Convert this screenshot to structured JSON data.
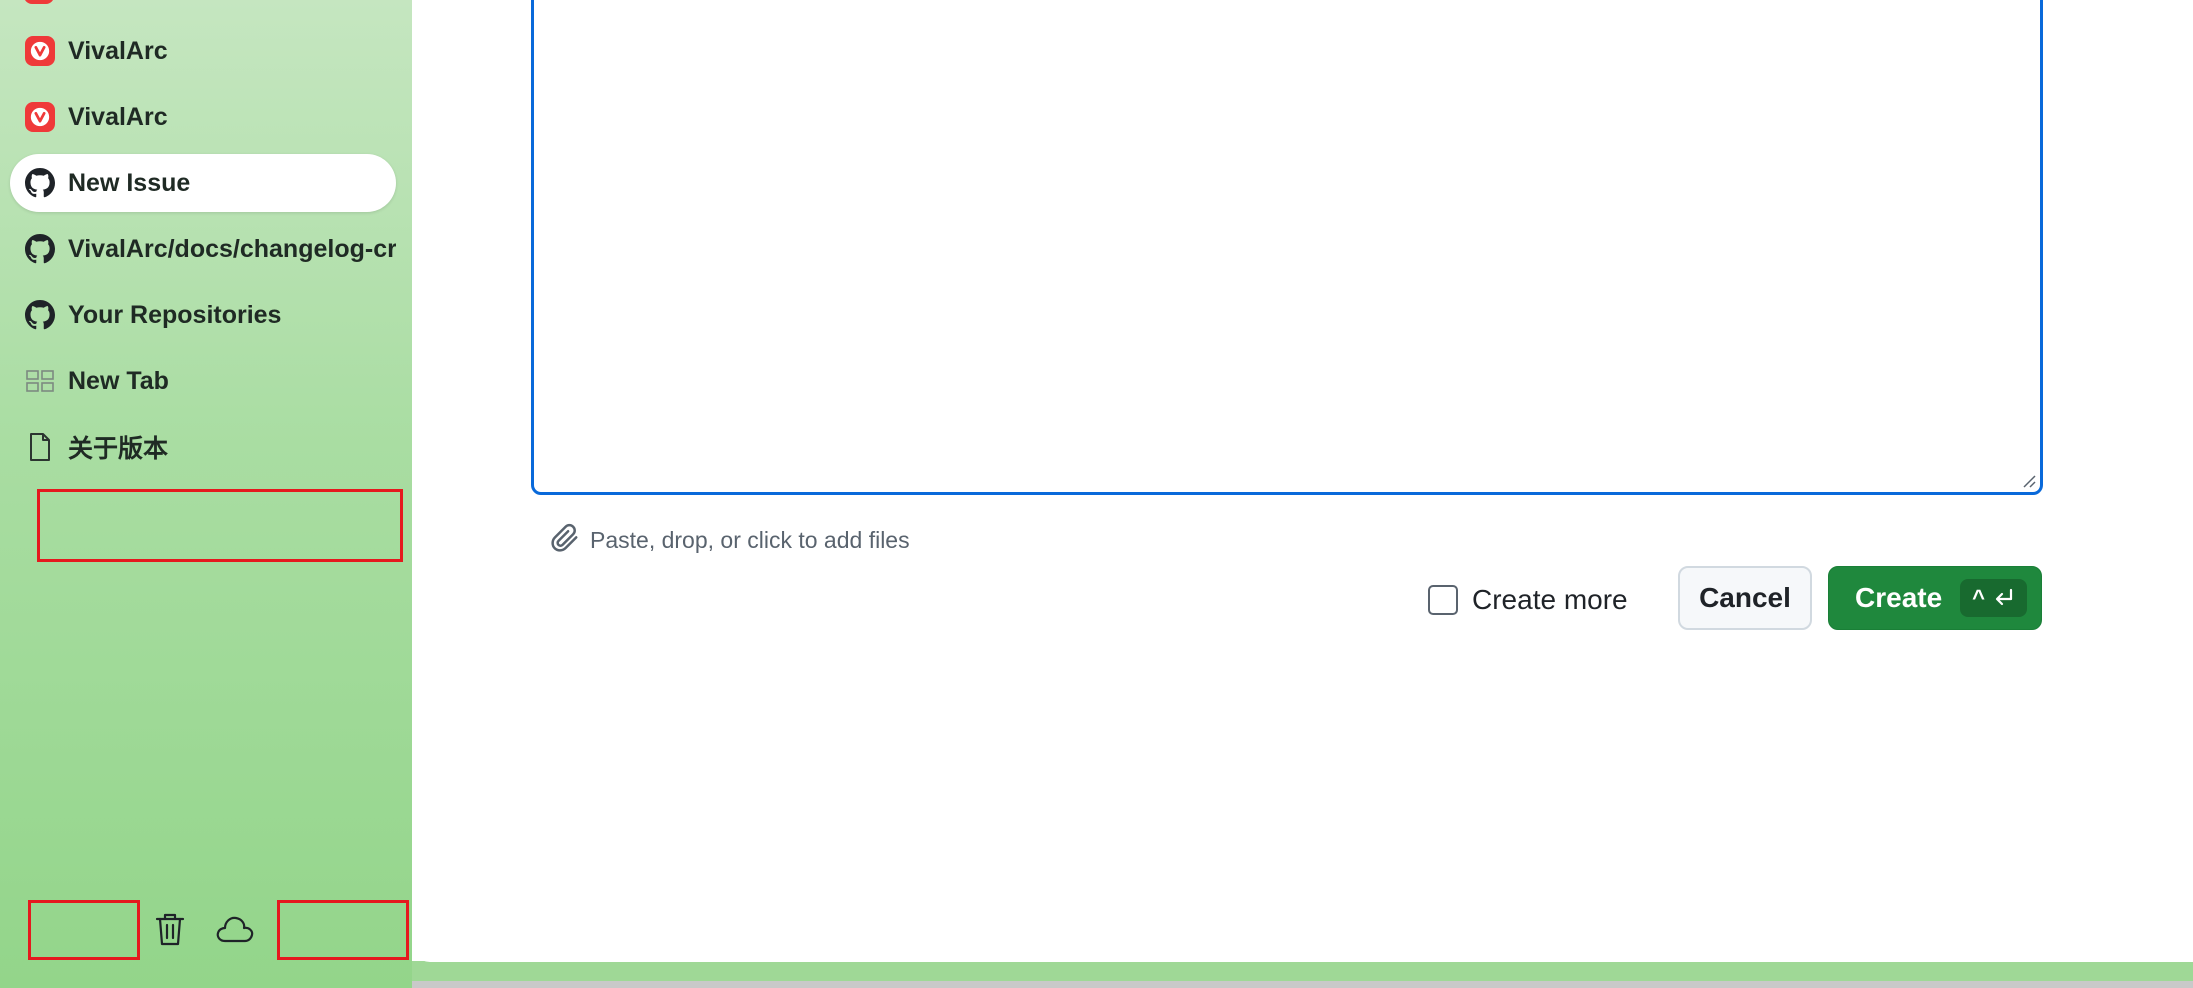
{
  "sidebar": {
    "tabs": [
      {
        "label": "VivalArc",
        "icon": "vivaldi-icon",
        "active": false
      },
      {
        "label": "VivalArc",
        "icon": "vivaldi-icon",
        "active": false
      },
      {
        "label": "New Issue",
        "icon": "github-icon",
        "active": true
      },
      {
        "label": "VivalArc/docs/changelog-cr",
        "icon": "github-icon",
        "active": false
      },
      {
        "label": "Your Repositories",
        "icon": "github-icon",
        "active": false
      },
      {
        "label": "New Tab",
        "icon": "grid-icon",
        "active": false
      },
      {
        "label": "关于版本",
        "icon": "document-icon",
        "active": false
      }
    ],
    "bottom_icons": [
      "trash-icon",
      "cloud-icon"
    ]
  },
  "form": {
    "attach_text": "Paste, drop, or click to add files",
    "create_more_label": "Create more",
    "create_more_checked": false,
    "cancel_label": "Cancel",
    "create_label": "Create",
    "shortcut_ctrl": "^",
    "shortcut_enter_icon": "return-icon"
  },
  "colors": {
    "accent_blue": "#0969da",
    "primary_green": "#1f883d",
    "vivaldi_red": "#ef3939",
    "sidebar_green": "#a9dda2",
    "highlight_red": "#e5191e"
  }
}
